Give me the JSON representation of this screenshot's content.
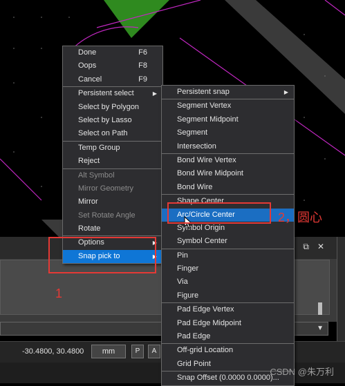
{
  "colors": {
    "canvas_bg": "#000000",
    "green_shape": "#2f8a1f",
    "gray_band": "#3a3a3a",
    "magenta_outline": "#c027c0",
    "menu_bg": "#2d2d30",
    "highlight": "#0f76d6",
    "annotation_red": "#e53935"
  },
  "left_menu": {
    "items": [
      {
        "label": "Done",
        "shortcut": "F6"
      },
      {
        "label": "Oops",
        "shortcut": "F8"
      },
      {
        "label": "Cancel",
        "shortcut": "F9"
      },
      {
        "label": "Persistent select",
        "submenu": true
      },
      {
        "label": "Select by Polygon"
      },
      {
        "label": "Select by Lasso"
      },
      {
        "label": "Select on Path"
      },
      {
        "label": "Temp Group"
      },
      {
        "label": "Reject"
      },
      {
        "label": "Alt Symbol",
        "disabled": true
      },
      {
        "label": "Mirror Geometry",
        "disabled": true
      },
      {
        "label": "Mirror"
      },
      {
        "label": "Set Rotate Angle",
        "disabled": true
      },
      {
        "label": "Rotate"
      },
      {
        "label": "Options",
        "submenu": true
      },
      {
        "label": "Snap pick to",
        "submenu": true,
        "highlighted": true
      }
    ]
  },
  "right_menu": {
    "items": [
      {
        "label": "Persistent snap",
        "submenu": true
      },
      {
        "label": "Segment Vertex"
      },
      {
        "label": "Segment Midpoint"
      },
      {
        "label": "Segment"
      },
      {
        "label": "Intersection"
      },
      {
        "label": "Bond Wire Vertex"
      },
      {
        "label": "Bond Wire Midpoint"
      },
      {
        "label": "Bond Wire"
      },
      {
        "label": "Shape Center"
      },
      {
        "label": "Arc/Circle Center",
        "highlighted": true
      },
      {
        "label": "Symbol Origin"
      },
      {
        "label": "Symbol Center"
      },
      {
        "label": "Pin"
      },
      {
        "label": "Finger"
      },
      {
        "label": "Via"
      },
      {
        "label": "Figure"
      },
      {
        "label": "Pad Edge Vertex"
      },
      {
        "label": "Pad Edge Midpoint"
      },
      {
        "label": "Pad Edge"
      },
      {
        "label": "Off-grid Location"
      },
      {
        "label": "Grid Point"
      },
      {
        "label": "Snap Offset (0.0000 0.0000)..."
      }
    ]
  },
  "status_bar": {
    "coordinates": "-30.4800, 30.4800",
    "units": "mm",
    "btn_p": "P",
    "btn_a": "A"
  },
  "panel_header_icons": {
    "dock": "⬓",
    "float": "⧉",
    "close": "✕"
  },
  "annotations": {
    "label_1": "1",
    "label_2": "2，圆心"
  },
  "watermark": "CSDN @朱万利"
}
